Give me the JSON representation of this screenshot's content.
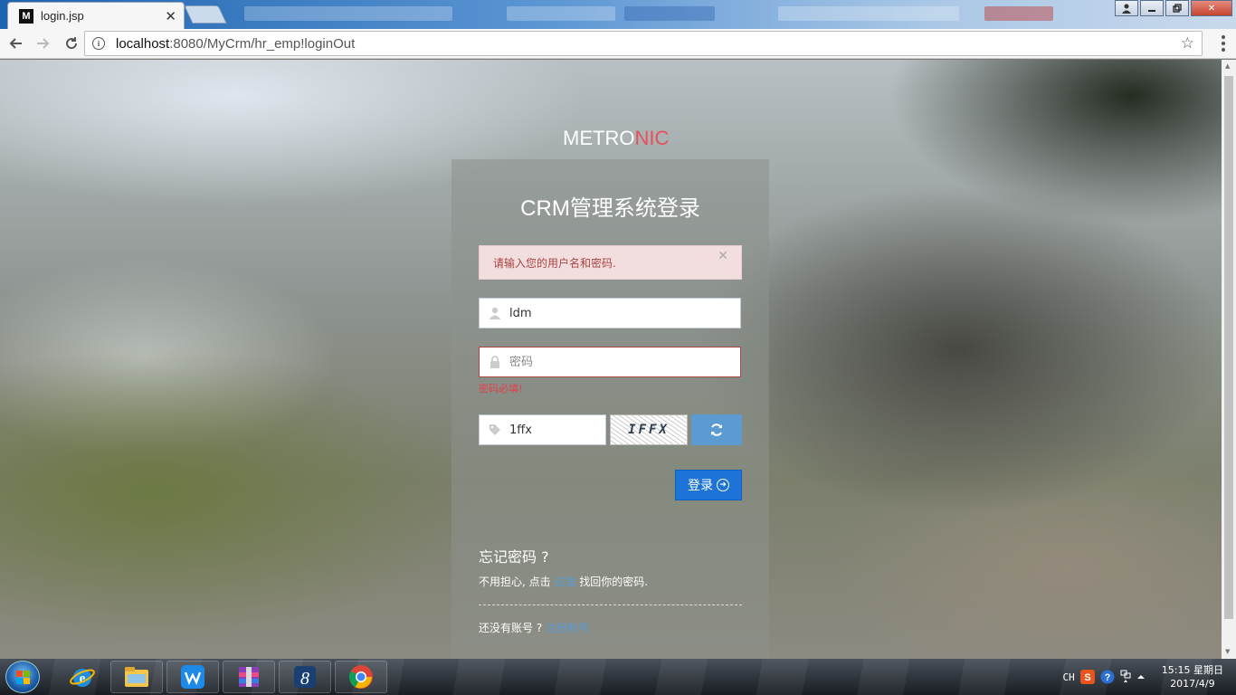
{
  "browser": {
    "tab_title": "login.jsp",
    "tab_favicon": "M",
    "url_host": "localhost",
    "url_path": ":8080/MyCrm/hr_emp!loginOut"
  },
  "page": {
    "logo_part1": "METRO",
    "logo_part2": "NIC",
    "form_title": "CRM管理系统登录",
    "alert_text": "请输入您的用户名和密码.",
    "username_value": "ldm",
    "password_placeholder": "密码",
    "password_error": "密码必填!",
    "captcha_value": "1ffx",
    "captcha_image_text": "IFFX",
    "login_button": "登录",
    "forget_title": "忘记密码 ?",
    "forget_text_before": "不用担心, 点击 ",
    "forget_link": "这里",
    "forget_text_after": " 找回你的密码.",
    "register_text": "还没有账号 ? ",
    "register_link": "注册账号"
  },
  "taskbar": {
    "lang": "CH",
    "time": "15:15 星期日",
    "date": "2017/4/9"
  },
  "colors": {
    "logo_accent": "#e7505a",
    "alert_bg": "#f2dede",
    "alert_text": "#a94442",
    "login_btn": "#1d74d6",
    "refresh_btn": "#5c9bd1",
    "link": "#5b9bd1"
  }
}
